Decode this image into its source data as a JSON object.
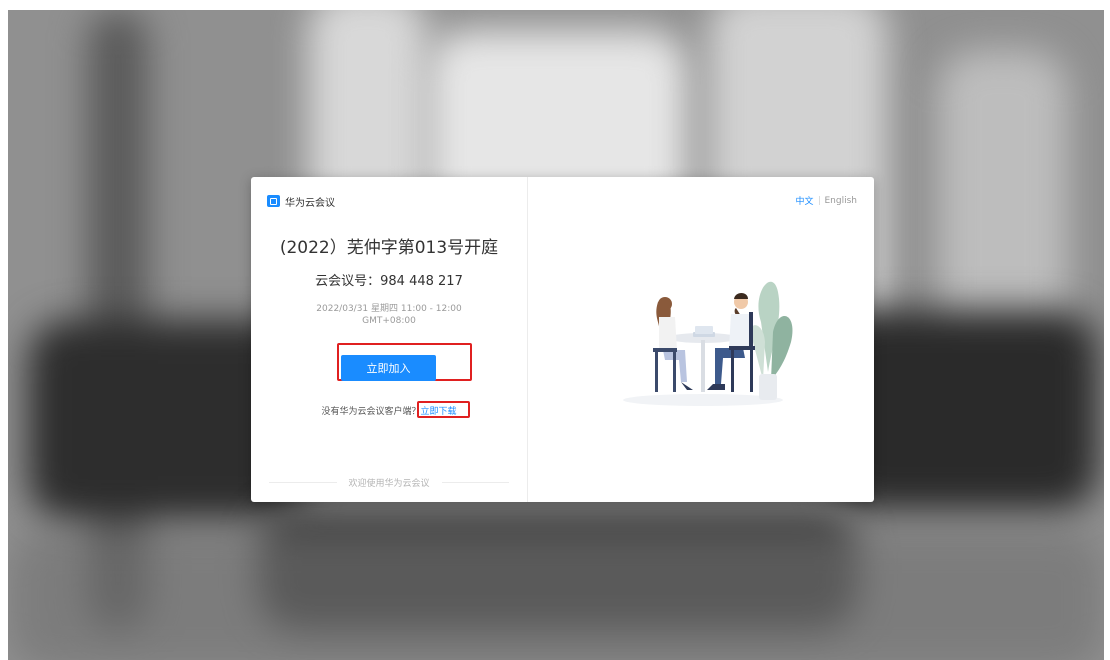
{
  "app": {
    "name": "华为云会议"
  },
  "meeting": {
    "title": "(2022）芜仲字第013号开庭",
    "id_label": "云会议号：984 448 217",
    "time_line1": "2022/03/31 星期四 11:00 - 12:00",
    "time_line2": "GMT+08:00"
  },
  "actions": {
    "join_label": "立即加入",
    "no_client_text": "没有华为云会议客户端？",
    "download_label": "立即下载"
  },
  "footer": {
    "welcome": "欢迎使用华为云会议"
  },
  "language": {
    "zh": "中文",
    "en": "English"
  },
  "colors": {
    "accent": "#1a8cff",
    "highlight": "#e02020"
  },
  "icons": {
    "logo": "huawei-cloud-meeting-logo-icon",
    "illustration": "meeting-illustration"
  }
}
